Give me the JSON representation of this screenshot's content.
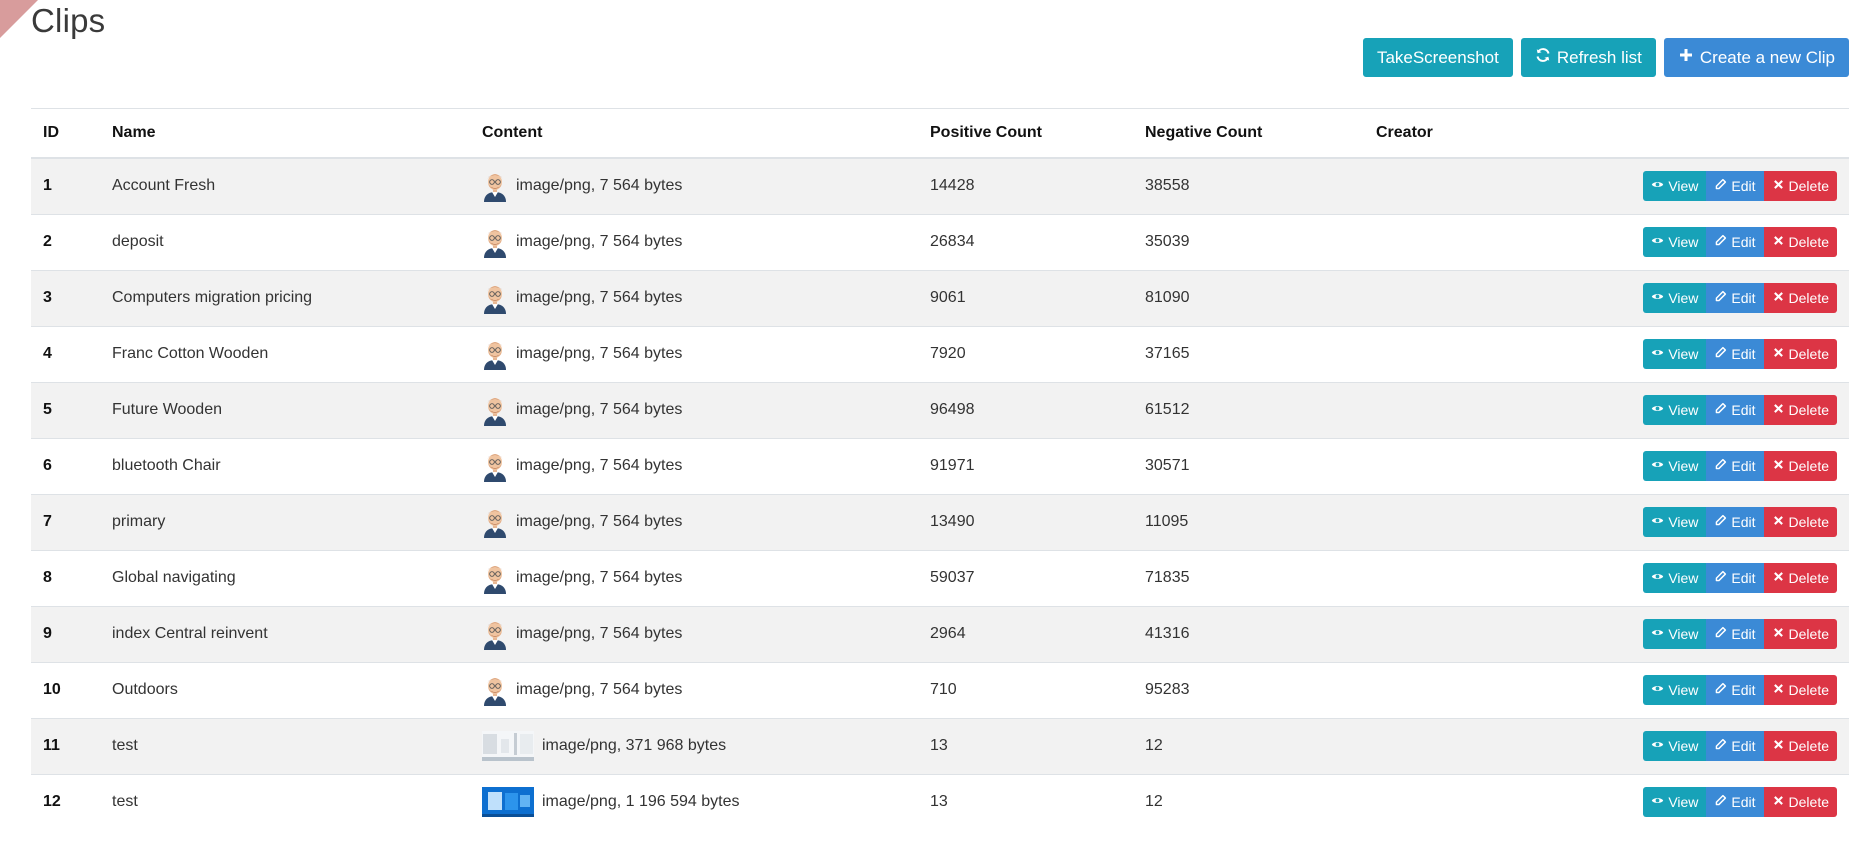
{
  "page": {
    "title": "Clips",
    "buttons": {
      "screenshot": "TakeScreenshot",
      "refresh": "Refresh list",
      "create": "Create a new Clip"
    }
  },
  "table": {
    "headers": {
      "id": "ID",
      "name": "Name",
      "content": "Content",
      "positive": "Positive Count",
      "negative": "Negative Count",
      "creator": "Creator"
    },
    "action_labels": {
      "view": "View",
      "edit": "Edit",
      "delete": "Delete"
    },
    "rows": [
      {
        "id": "1",
        "name": "Account Fresh",
        "content": "image/png, 7 564 bytes",
        "thumb": "avatar",
        "positive": "14428",
        "negative": "38558",
        "creator": ""
      },
      {
        "id": "2",
        "name": "deposit",
        "content": "image/png, 7 564 bytes",
        "thumb": "avatar",
        "positive": "26834",
        "negative": "35039",
        "creator": ""
      },
      {
        "id": "3",
        "name": "Computers migration pricing",
        "content": "image/png, 7 564 bytes",
        "thumb": "avatar",
        "positive": "9061",
        "negative": "81090",
        "creator": ""
      },
      {
        "id": "4",
        "name": "Franc Cotton Wooden",
        "content": "image/png, 7 564 bytes",
        "thumb": "avatar",
        "positive": "7920",
        "negative": "37165",
        "creator": ""
      },
      {
        "id": "5",
        "name": "Future Wooden",
        "content": "image/png, 7 564 bytes",
        "thumb": "avatar",
        "positive": "96498",
        "negative": "61512",
        "creator": ""
      },
      {
        "id": "6",
        "name": "bluetooth Chair",
        "content": "image/png, 7 564 bytes",
        "thumb": "avatar",
        "positive": "91971",
        "negative": "30571",
        "creator": ""
      },
      {
        "id": "7",
        "name": "primary",
        "content": "image/png, 7 564 bytes",
        "thumb": "avatar",
        "positive": "13490",
        "negative": "11095",
        "creator": ""
      },
      {
        "id": "8",
        "name": "Global navigating",
        "content": "image/png, 7 564 bytes",
        "thumb": "avatar",
        "positive": "59037",
        "negative": "71835",
        "creator": ""
      },
      {
        "id": "9",
        "name": "index Central reinvent",
        "content": "image/png, 7 564 bytes",
        "thumb": "avatar",
        "positive": "2964",
        "negative": "41316",
        "creator": ""
      },
      {
        "id": "10",
        "name": "Outdoors",
        "content": "image/png, 7 564 bytes",
        "thumb": "avatar",
        "positive": "710",
        "negative": "95283",
        "creator": ""
      },
      {
        "id": "11",
        "name": "test",
        "content": "image/png, 371 968 bytes",
        "thumb": "screenshot-light",
        "positive": "13",
        "negative": "12",
        "creator": ""
      },
      {
        "id": "12",
        "name": "test",
        "content": "image/png, 1 196 594 bytes",
        "thumb": "screenshot-blue",
        "positive": "13",
        "negative": "12",
        "creator": ""
      }
    ]
  },
  "colors": {
    "info": "#17a2b8",
    "primary": "#3b8ad6",
    "danger": "#dc3545",
    "ribbon": "#d89c9c"
  },
  "icons": {
    "refresh": "refresh-icon",
    "create": "plus-icon",
    "view": "eye-icon",
    "edit": "pencil-icon",
    "delete": "x-icon"
  }
}
